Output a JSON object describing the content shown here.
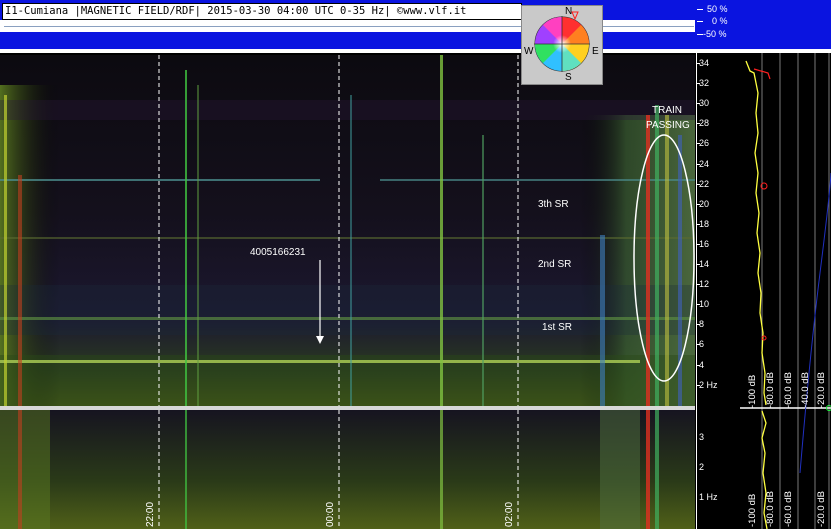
{
  "header": {
    "title": "I1-Cumiana |MAGNETIC FIELD/RDF| 2015-03-30 04:00 UTC 0-35 Hz| ©www.vlf.it"
  },
  "compass": {
    "n": "N",
    "s": "S",
    "e": "E",
    "w": "W"
  },
  "percent_scale": [
    "50 %",
    "0 %",
    "-50 %"
  ],
  "freq_axis_top": [
    "34",
    "32",
    "30",
    "28",
    "26",
    "24",
    "22",
    "20",
    "18",
    "16",
    "14",
    "12",
    "10",
    "8",
    "6",
    "4",
    "2 Hz"
  ],
  "freq_axis_bottom": [
    "3",
    "2",
    "1 Hz"
  ],
  "time_labels": [
    "22:00",
    "00:00",
    "02:00"
  ],
  "annotations": {
    "train": [
      "TRAIN",
      "PASSING"
    ],
    "sr3": "3th SR",
    "sr2": "2nd SR",
    "sr1": "1st SR",
    "event_id": "4005166231"
  },
  "db_labels": [
    "-100 dB",
    "-80.0 dB",
    "-60.0 dB",
    "-40.0 dB",
    "-20.0 dB"
  ],
  "colors": {
    "header_blue": "#0a14e0",
    "ellipse": "#ffffff",
    "trace": "#ffff40",
    "marker": "#ff2020"
  }
}
